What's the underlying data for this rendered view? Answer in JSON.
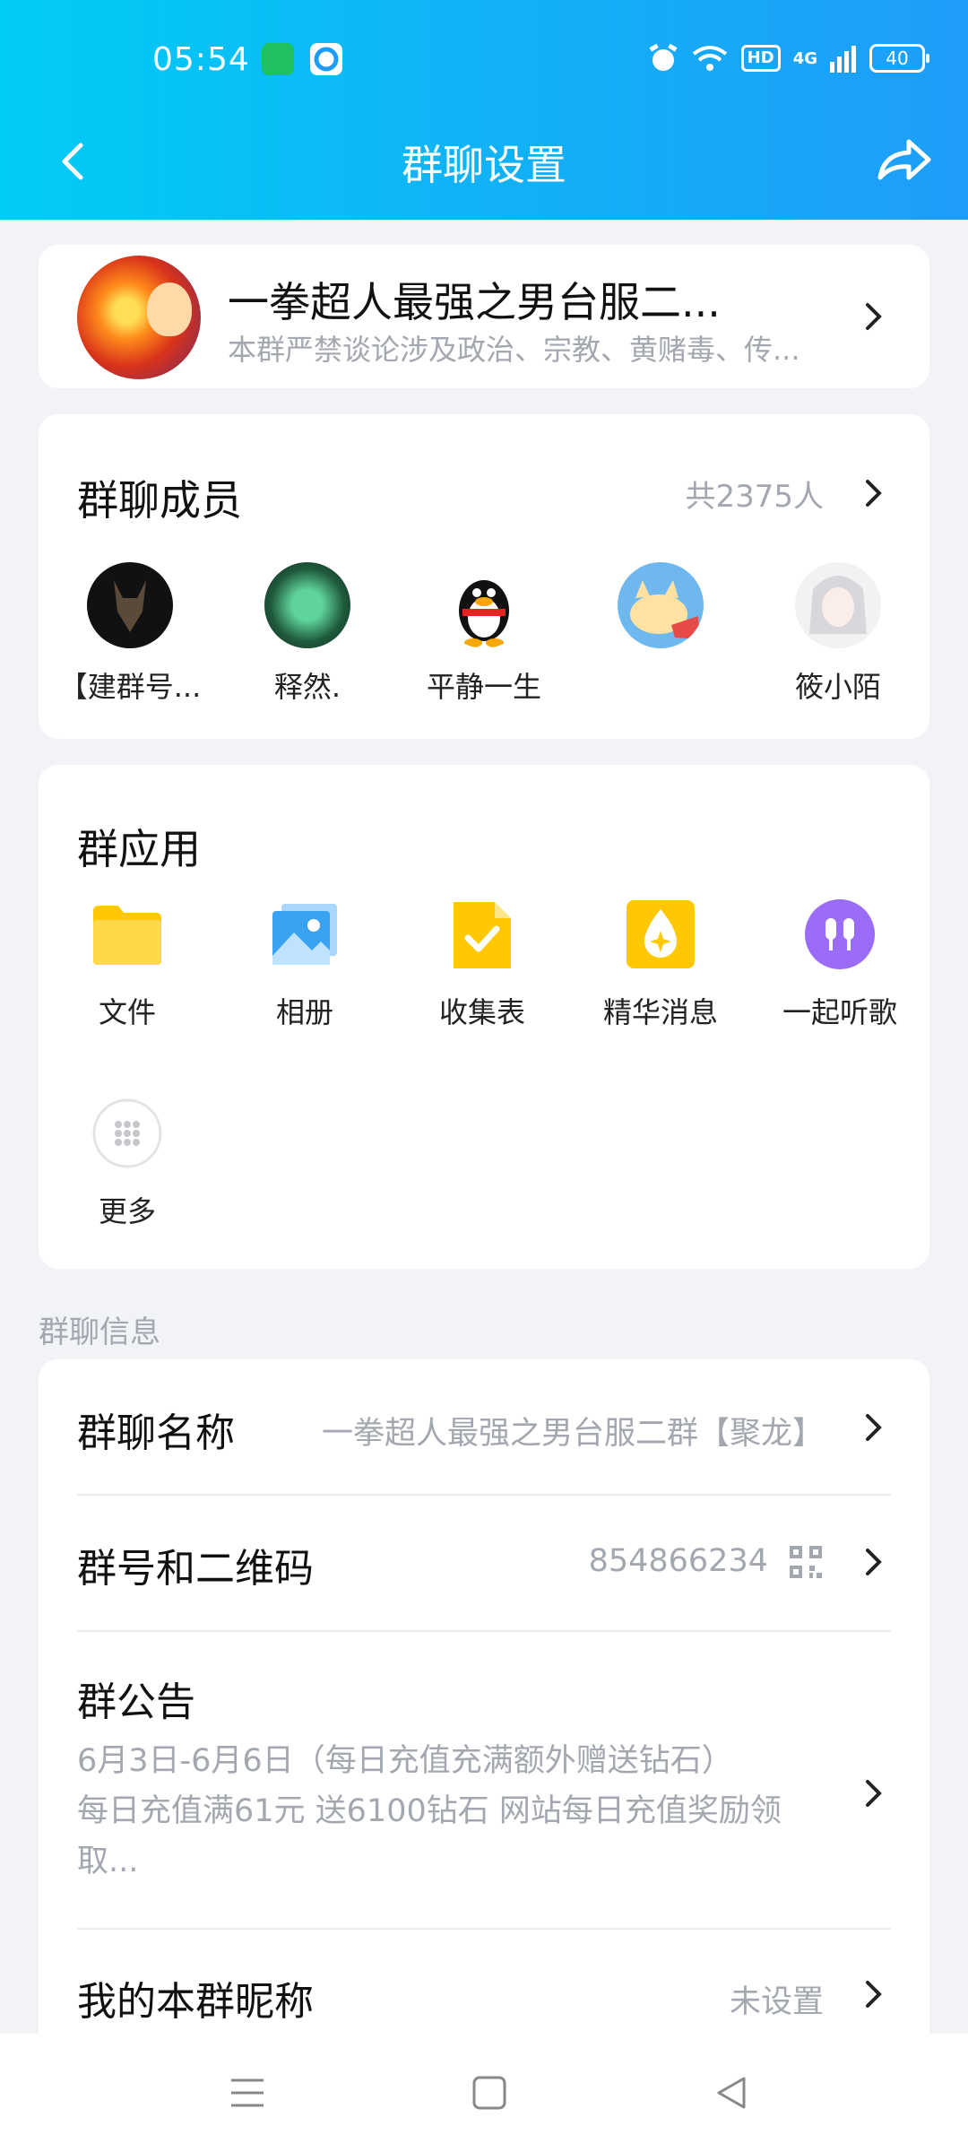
{
  "status_bar": {
    "time": "05:54",
    "hd": "HD",
    "network": "4G",
    "battery": "40"
  },
  "nav": {
    "title": "群聊设置"
  },
  "group": {
    "name": "一拳超人最强之男台服二...",
    "description": "本群严禁谈论涉及政治、宗教、黄赌毒、传..."
  },
  "members": {
    "title": "群聊成员",
    "count": "共2375人",
    "list": [
      {
        "name": "【建群号..."
      },
      {
        "name": "释然."
      },
      {
        "name": "平静一生"
      },
      {
        "name": ""
      },
      {
        "name": "筱小陌"
      }
    ]
  },
  "apps": {
    "title": "群应用",
    "items": [
      {
        "label": "文件",
        "icon": "folder-icon"
      },
      {
        "label": "相册",
        "icon": "album-icon"
      },
      {
        "label": "收集表",
        "icon": "form-icon"
      },
      {
        "label": "精华消息",
        "icon": "essence-icon"
      },
      {
        "label": "一起听歌",
        "icon": "headphones-icon"
      },
      {
        "label": "更多",
        "icon": "more-grid-icon"
      }
    ]
  },
  "info": {
    "section_label": "群聊信息",
    "group_name_label": "群聊名称",
    "group_name_value": "一拳超人最强之男台服二群【聚龙】",
    "group_id_label": "群号和二维码",
    "group_id_value": "854866234",
    "notice_label": "群公告",
    "notice_line1": "6月3日-6月6日（每日充值充满额外赠送钻石）",
    "notice_line2": "每日充值满61元 送6100钻石 网站每日充值奖励领",
    "notice_line3": "取...",
    "nickname_label": "我的本群昵称",
    "nickname_value": "未设置"
  },
  "colors": {
    "header_start": "#00cdf5",
    "header_end": "#1e9df8",
    "background": "#f2f3f7",
    "secondary_text": "#a3a7b0"
  }
}
